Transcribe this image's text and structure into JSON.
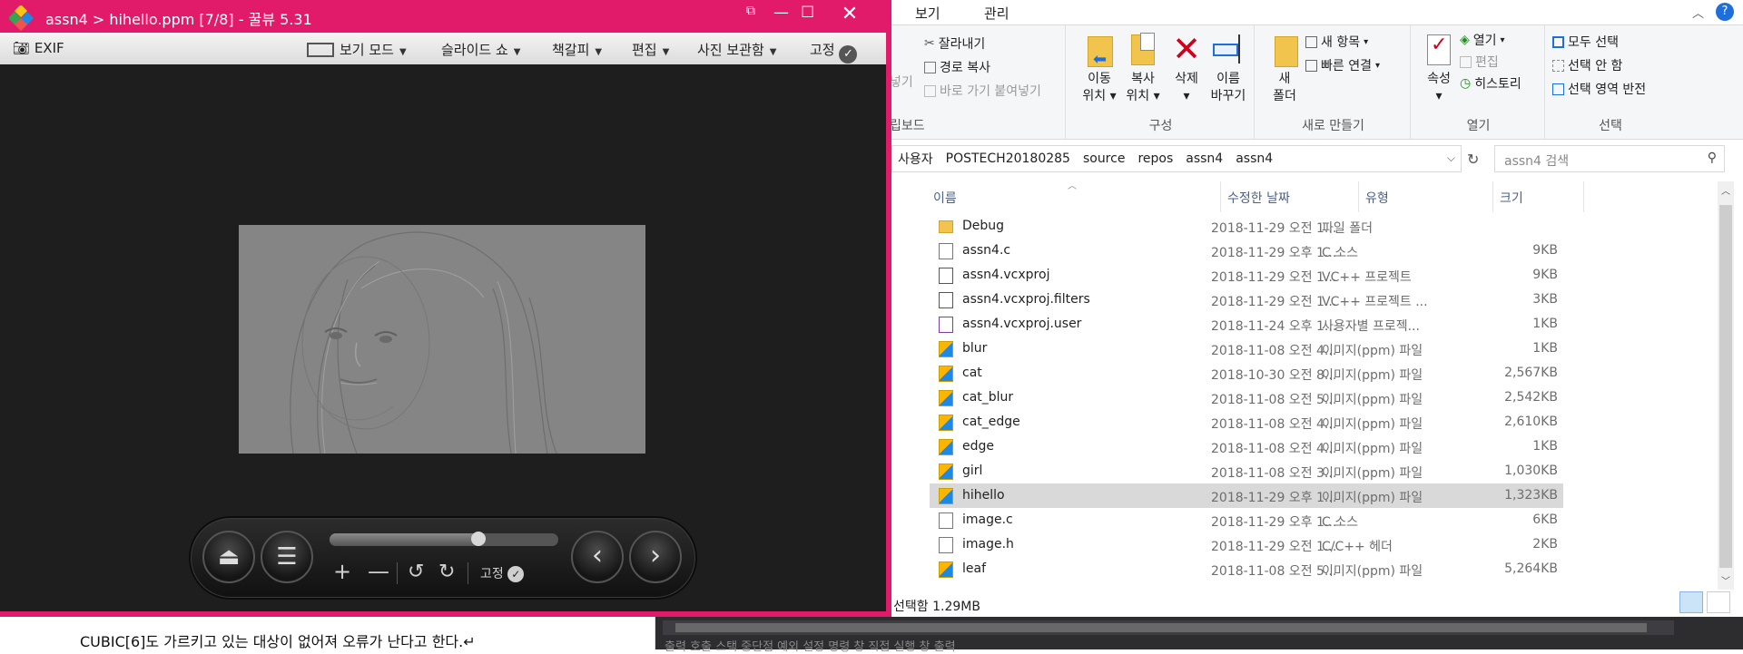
{
  "viewer": {
    "title": "assn4 > hihello.ppm [7/8] - 꿀뷰 5.31",
    "toolbar": {
      "exif": "EXIF",
      "view_mode": "보기 모드",
      "slideshow": "슬라이드 쇼",
      "bookmark": "책갈피",
      "edit": "편집",
      "photo_gallery": "사진 보관함",
      "pin": "고정"
    },
    "controls": {
      "pin": "고정",
      "seek_fraction": 0.65
    }
  },
  "explorer": {
    "ribbon_tabs": [
      "보기",
      "관리"
    ],
    "clipboard": {
      "title": "립보드",
      "cut": "잘라내기",
      "copy_path": "경로 복사",
      "paste_shortcut": "바로 가기 붙여넣기",
      "paste_fragment": "넣기"
    },
    "organize": {
      "title": "구성",
      "move_to": [
        "이동",
        "위치"
      ],
      "copy_to": [
        "복사",
        "위치"
      ],
      "delete": "삭제",
      "rename": [
        "이름",
        "바꾸기"
      ]
    },
    "new": {
      "title": "새로 만들기",
      "new_folder": [
        "새",
        "폴더"
      ],
      "new_item": "새 항목",
      "easy_access": "빠른 연결"
    },
    "open": {
      "title": "열기",
      "properties": "속성",
      "open": "열기",
      "edit": "편집",
      "history": "히스토리"
    },
    "select": {
      "title": "선택",
      "select_all": "모두 선택",
      "select_none": "선택 안 함",
      "invert": "선택 영역 반전"
    },
    "breadcrumb": [
      "사용자",
      "POSTECH20180285",
      "source",
      "repos",
      "assn4",
      "assn4"
    ],
    "search_placeholder": "assn4 검색",
    "columns": {
      "name": "이름",
      "date": "수정한 날짜",
      "type": "유형",
      "size": "크기"
    },
    "files": [
      {
        "name": "Debug",
        "date": "2018-11-29 오전 1...",
        "type": "파일 폴더",
        "size": "",
        "icon": "folder-icon"
      },
      {
        "name": "assn4.c",
        "date": "2018-11-29 오후 1...",
        "type": "C 소스",
        "size": "9KB",
        "icon": "c-file-icon"
      },
      {
        "name": "assn4.vcxproj",
        "date": "2018-11-29 오전 1...",
        "type": "VC++ 프로젝트",
        "size": "9KB",
        "icon": "project-icon"
      },
      {
        "name": "assn4.vcxproj.filters",
        "date": "2018-11-29 오전 1...",
        "type": "VC++ 프로젝트 ...",
        "size": "3KB",
        "icon": "filters-icon"
      },
      {
        "name": "assn4.vcxproj.user",
        "date": "2018-11-24 오후 1...",
        "type": "사용자별 프로젝...",
        "size": "1KB",
        "icon": "user-project-icon"
      },
      {
        "name": "blur",
        "date": "2018-11-08 오전 4...",
        "type": "이미지(ppm) 파일",
        "size": "1KB",
        "icon": "image-file-icon"
      },
      {
        "name": "cat",
        "date": "2018-10-30 오전 8...",
        "type": "이미지(ppm) 파일",
        "size": "2,567KB",
        "icon": "image-file-icon"
      },
      {
        "name": "cat_blur",
        "date": "2018-11-08 오전 5...",
        "type": "이미지(ppm) 파일",
        "size": "2,542KB",
        "icon": "image-file-icon"
      },
      {
        "name": "cat_edge",
        "date": "2018-11-08 오전 4...",
        "type": "이미지(ppm) 파일",
        "size": "2,610KB",
        "icon": "image-file-icon"
      },
      {
        "name": "edge",
        "date": "2018-11-08 오전 4...",
        "type": "이미지(ppm) 파일",
        "size": "1KB",
        "icon": "image-file-icon"
      },
      {
        "name": "girl",
        "date": "2018-11-08 오전 3...",
        "type": "이미지(ppm) 파일",
        "size": "1,030KB",
        "icon": "image-file-icon"
      },
      {
        "name": "hihello",
        "date": "2018-11-29 오후 1...",
        "type": "이미지(ppm) 파일",
        "size": "1,323KB",
        "icon": "image-file-icon",
        "selected": true
      },
      {
        "name": "image.c",
        "date": "2018-11-29 오후 1...",
        "type": "C 소스",
        "size": "6KB",
        "icon": "c-file-icon"
      },
      {
        "name": "image.h",
        "date": "2018-11-29 오전 1...",
        "type": "C/C++ 헤더",
        "size": "2KB",
        "icon": "h-file-icon"
      },
      {
        "name": "leaf",
        "date": "2018-11-08 오전 5...",
        "type": "이미지(ppm) 파일",
        "size": "5,264KB",
        "icon": "image-file-icon"
      }
    ],
    "status": "선택함 1.29MB"
  },
  "document": {
    "text": "CUBIC[6]도 가르키고 있는 대상이 없어져 오류가 난다고 한다.↵"
  },
  "vs": {
    "text": "출력   호출 스택   중단점   예외 설정   명령 창   직접 실행 창   출력"
  }
}
